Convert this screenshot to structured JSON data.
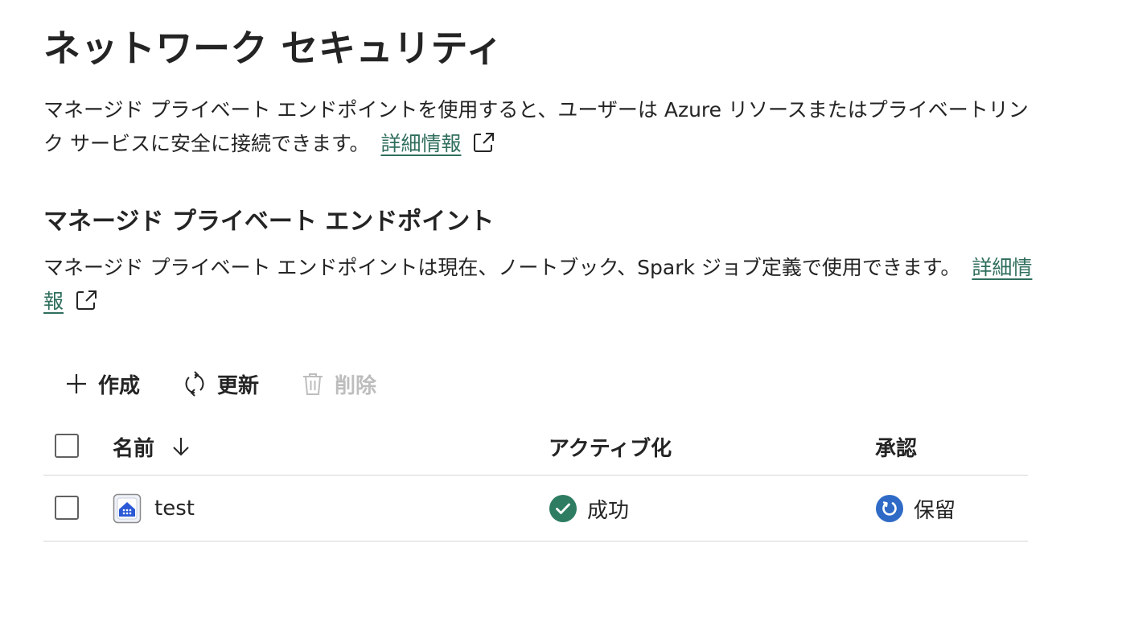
{
  "header": {
    "title": "ネットワーク セキュリティ",
    "description": "マネージド プライベート エンドポイントを使用すると、ユーザーは Azure リソースまたはプライベートリンク サービスに安全に接続できます。",
    "learn_more": "詳細情報"
  },
  "section": {
    "title": "マネージド プライベート エンドポイント",
    "description": "マネージド プライベート エンドポイントは現在、ノートブック、Spark ジョブ定義で使用できます。",
    "learn_more": "詳細情報"
  },
  "toolbar": {
    "create": {
      "label": "作成",
      "icon": "plus-icon",
      "enabled": true
    },
    "refresh": {
      "label": "更新",
      "icon": "refresh-icon",
      "enabled": true
    },
    "delete": {
      "label": "削除",
      "icon": "trash-icon",
      "enabled": false
    }
  },
  "table": {
    "columns": {
      "name": "名前",
      "activation": "アクティブ化",
      "approval": "承認"
    },
    "sort": {
      "column": "name",
      "direction": "descending",
      "icon": "arrow-down-icon"
    },
    "rows": [
      {
        "name": "test",
        "icon": "private-endpoint-icon",
        "activation": "成功",
        "activation_icon": "check-circle-icon",
        "approval": "保留",
        "approval_icon": "pending-circle-icon"
      }
    ]
  },
  "colors": {
    "link": "#2f6e5d",
    "success": "#2e7d62",
    "pending": "#2f6bc6",
    "disabled": "#bdbdbd"
  }
}
